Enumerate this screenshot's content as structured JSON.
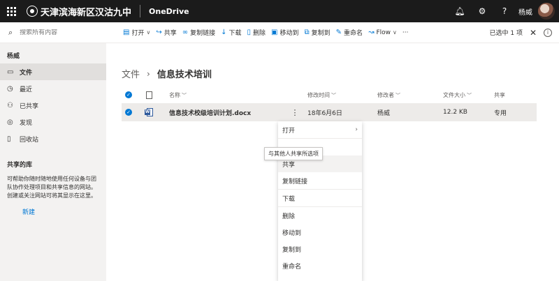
{
  "suite": {
    "org_name": "天津滨海新区汉沽九中",
    "app_name": "OneDrive",
    "user_name": "杨威",
    "icons": [
      "waffle-icon",
      "bell-icon",
      "gear-icon",
      "help-icon"
    ]
  },
  "search": {
    "placeholder": "搜索所有内容"
  },
  "commands": {
    "open": "打开",
    "share": "共享",
    "copy_link": "复制链接",
    "download": "下载",
    "delete": "删除",
    "move_to": "移动到",
    "copy_to": "复制到",
    "rename": "重命名",
    "flow": "Flow",
    "more": "···",
    "selected": "已选中 1 项",
    "close": "✕",
    "info": "i"
  },
  "nav": {
    "user": "杨威",
    "items": [
      {
        "label": "文件",
        "icon": "folder-icon"
      },
      {
        "label": "最近",
        "icon": "clock-icon"
      },
      {
        "label": "已共享",
        "icon": "people-icon"
      },
      {
        "label": "发现",
        "icon": "discover-icon"
      },
      {
        "label": "回收站",
        "icon": "recycle-bin-icon"
      }
    ],
    "shared_libraries": "共享的库",
    "shared_desc": "可帮助你随时随地使用任何设备与团队协作处理项目和共享信息的网站。创建或关注网站可将其显示在这里。",
    "new_link": "新建"
  },
  "breadcrumb": {
    "root": "文件",
    "sep": "›",
    "current": "信息技术培训"
  },
  "columns": {
    "name": "名称",
    "modified": "修改时间",
    "modified_by": "修改者",
    "size": "文件大小",
    "sharing": "共享",
    "sort_chevron": "﹀"
  },
  "file": {
    "name": "信息技术校级培训计划.docx",
    "more": "⋮",
    "modified": "18年6月6日",
    "modified_by": "杨威",
    "size": "12.2 KB",
    "sharing": "专用"
  },
  "context_menu": {
    "open": "打开",
    "arrow": "›",
    "share": "共享",
    "copy_link": "复制链接",
    "download": "下载",
    "delete": "删除",
    "move_to": "移动到",
    "copy_to": "复制到",
    "rename": "重命名"
  },
  "tooltip": "与其他人共享所选项",
  "colors": {
    "accent": "#0078d4",
    "suite_bg": "#1b1b1b",
    "word": "#2b579a"
  }
}
